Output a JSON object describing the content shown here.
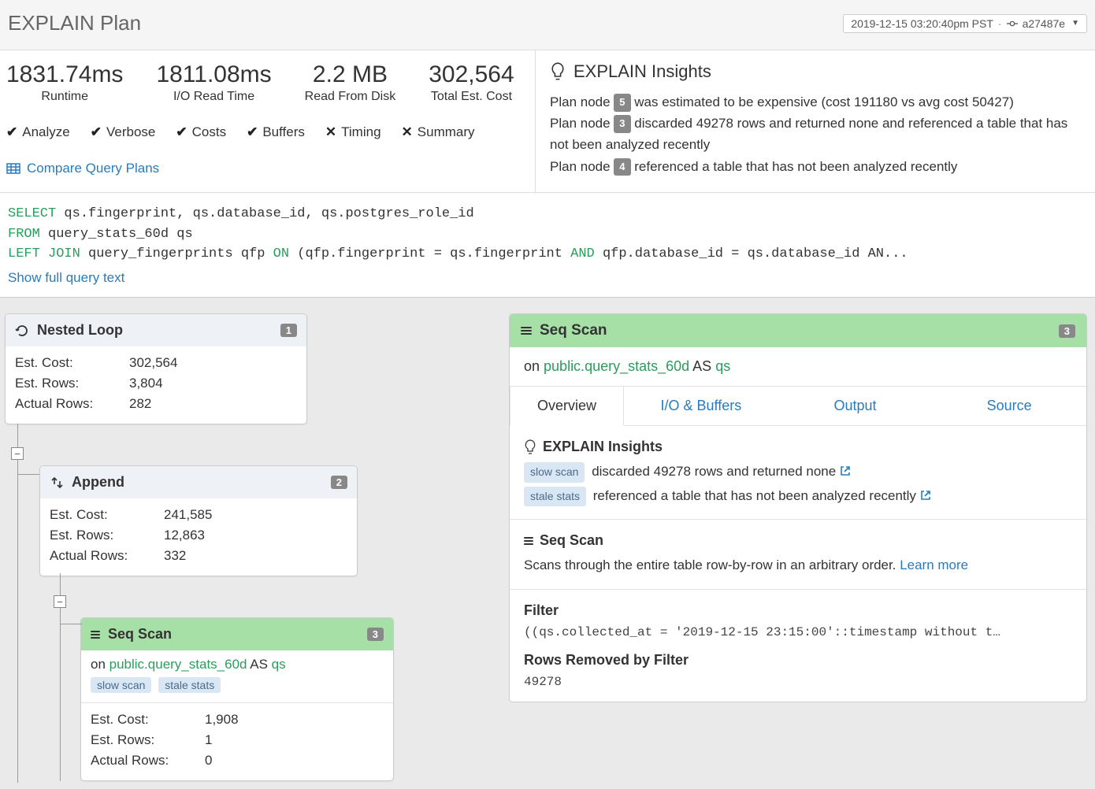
{
  "header": {
    "title": "EXPLAIN Plan",
    "timestamp": "2019-12-15 03:20:40pm PST",
    "commit": "a27487e"
  },
  "metrics": [
    {
      "value": "1831.74ms",
      "label": "Runtime"
    },
    {
      "value": "1811.08ms",
      "label": "I/O Read Time"
    },
    {
      "value": "2.2 MB",
      "label": "Read From Disk"
    },
    {
      "value": "302,564",
      "label": "Total Est. Cost"
    }
  ],
  "flags": [
    {
      "on": true,
      "label": "Analyze"
    },
    {
      "on": true,
      "label": "Verbose"
    },
    {
      "on": true,
      "label": "Costs"
    },
    {
      "on": true,
      "label": "Buffers"
    },
    {
      "on": false,
      "label": "Timing"
    },
    {
      "on": false,
      "label": "Summary"
    }
  ],
  "compare_label": "Compare Query Plans",
  "insights": {
    "heading": "EXPLAIN Insights",
    "items": [
      {
        "prefix": "Plan node ",
        "node": "5",
        "text": " was estimated to be expensive (cost 191180 vs avg cost 50427)"
      },
      {
        "prefix": "Plan node ",
        "node": "3",
        "text": " discarded 49278 rows and returned none and referenced a table that has not been analyzed recently"
      },
      {
        "prefix": "Plan node ",
        "node": "4",
        "text": " referenced a table that has not been analyzed recently"
      }
    ]
  },
  "sql": {
    "line1_pre": "SELECT",
    "line1_rest": " qs.fingerprint, qs.database_id, qs.postgres_role_id",
    "line2_pre": "FROM",
    "line2_rest": " query_stats_60d qs",
    "line3_a": "LEFT JOIN",
    "line3_mid": " query_fingerprints qfp ",
    "line3_b": "ON",
    "line3_c": " (qfp.fingerprint = qs.fingerprint ",
    "line3_d": "AND",
    "line3_e": " qfp.database_id = qs.database_id AN...",
    "show_full": "Show full query text"
  },
  "tree": {
    "n1": {
      "title": "Nested Loop",
      "badge": "1",
      "rows": [
        [
          "Est. Cost:",
          "302,564"
        ],
        [
          "Est. Rows:",
          "3,804"
        ],
        [
          "Actual Rows:",
          "282"
        ]
      ]
    },
    "n2": {
      "title": "Append",
      "badge": "2",
      "rows": [
        [
          "Est. Cost:",
          "241,585"
        ],
        [
          "Est. Rows:",
          "12,863"
        ],
        [
          "Actual Rows:",
          "332"
        ]
      ]
    },
    "n3": {
      "title": "Seq Scan",
      "badge": "3",
      "on_pre": "on ",
      "on_table": "public.query_stats_60d",
      "on_mid": " AS ",
      "on_alias": "qs",
      "tags": [
        "slow scan",
        "stale stats"
      ],
      "rows": [
        [
          "Est. Cost:",
          "1,908"
        ],
        [
          "Est. Rows:",
          "1"
        ],
        [
          "Actual Rows:",
          "0"
        ]
      ]
    }
  },
  "detail": {
    "title": "Seq Scan",
    "badge": "3",
    "on_pre": "on ",
    "on_table": "public.query_stats_60d",
    "on_mid": " AS ",
    "on_alias": "qs",
    "tabs": [
      "Overview",
      "I/O & Buffers",
      "Output",
      "Source"
    ],
    "active_tab": 0,
    "insights_heading": "EXPLAIN Insights",
    "insight_lines": [
      {
        "tag": "slow scan",
        "text": "discarded 49278 rows and returned none"
      },
      {
        "tag": "stale stats",
        "text": "referenced a table that has not been analyzed recently"
      }
    ],
    "op_heading": "Seq Scan",
    "op_desc": "Scans through the entire table row-by-row in an arbitrary order. ",
    "learn_more": "Learn more",
    "filter_heading": "Filter",
    "filter_expr": "((qs.collected_at = '2019-12-15 23:15:00'::timestamp without t…",
    "rows_removed_heading": "Rows Removed by Filter",
    "rows_removed": "49278"
  }
}
